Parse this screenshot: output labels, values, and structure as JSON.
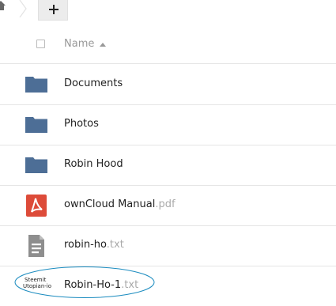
{
  "toolbar": {
    "add_symbol": "+"
  },
  "table": {
    "name_header": "Name",
    "rows": [
      {
        "icon": "folder-icon",
        "name": "Documents",
        "ext": ""
      },
      {
        "icon": "folder-icon",
        "name": "Photos",
        "ext": ""
      },
      {
        "icon": "folder-icon",
        "name": "Robin Hood",
        "ext": ""
      },
      {
        "icon": "pdf-icon",
        "name": "ownCloud Manual",
        "ext": ".pdf"
      },
      {
        "icon": "text-file-icon",
        "name": "robin-ho",
        "ext": ".txt"
      },
      {
        "icon": "steemit-utopian-logo",
        "name": "Robin-Ho-1",
        "ext": ".txt"
      }
    ],
    "logo_text": {
      "line1": "Steemit",
      "line2": "Utopian-io"
    }
  },
  "colors": {
    "folder": "#4d6e96",
    "pdf": "#dd4b39",
    "text_file": "#8e8e8e",
    "annotation": "#1a8bbf"
  }
}
